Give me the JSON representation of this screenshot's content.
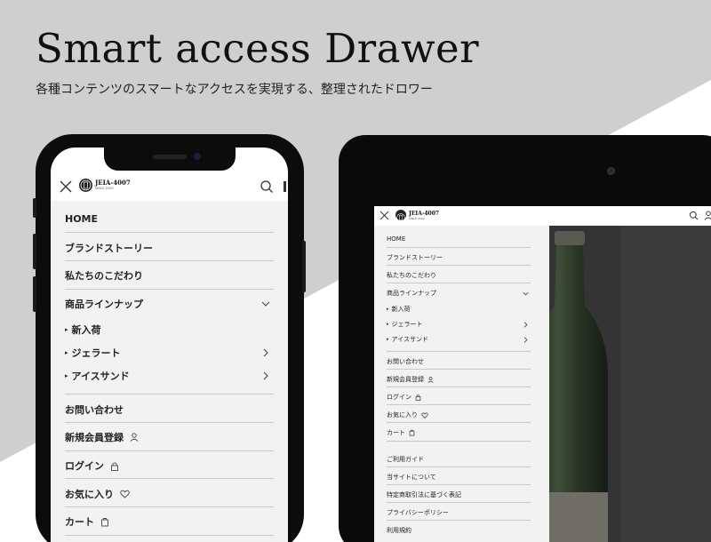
{
  "hero": {
    "title": "Smart access Drawer",
    "subtitle": "各種コンテンツのスマートなアクセスを実現する、整理されたドロワー"
  },
  "brand": {
    "logo_title": "JEIA-4007",
    "logo_sub": "SINCE 2020"
  },
  "phone_menu": {
    "items": [
      "HOME",
      "ブランドストーリー",
      "私たちのこだわり",
      "商品ラインナップ"
    ],
    "subitems": [
      "新入荷",
      "ジェラート",
      "アイスサンド"
    ],
    "after_items": [
      "お問い合わせ",
      "新規会員登録",
      "ログイン",
      "お気に入り",
      "カート"
    ]
  },
  "tablet_menu": {
    "items": [
      "HOME",
      "ブランドストーリー",
      "私たちのこだわり",
      "商品ラインナップ"
    ],
    "subitems": [
      "新入荷",
      "ジェラート",
      "アイスサンド"
    ],
    "after_items": [
      "お問い合わせ",
      "新規会員登録",
      "ログイン",
      "お気に入り",
      "カート"
    ],
    "footer_items": [
      "ご利用ガイド",
      "当サイトについて",
      "特定商取引法に基づく表記",
      "プライバシーポリシー",
      "利用規約"
    ]
  },
  "colors": {
    "background": "#cfcfcf",
    "drawer": "#f2f2f2",
    "device": "#0c0c0c",
    "photo_overlay": "#3d3d3d"
  }
}
